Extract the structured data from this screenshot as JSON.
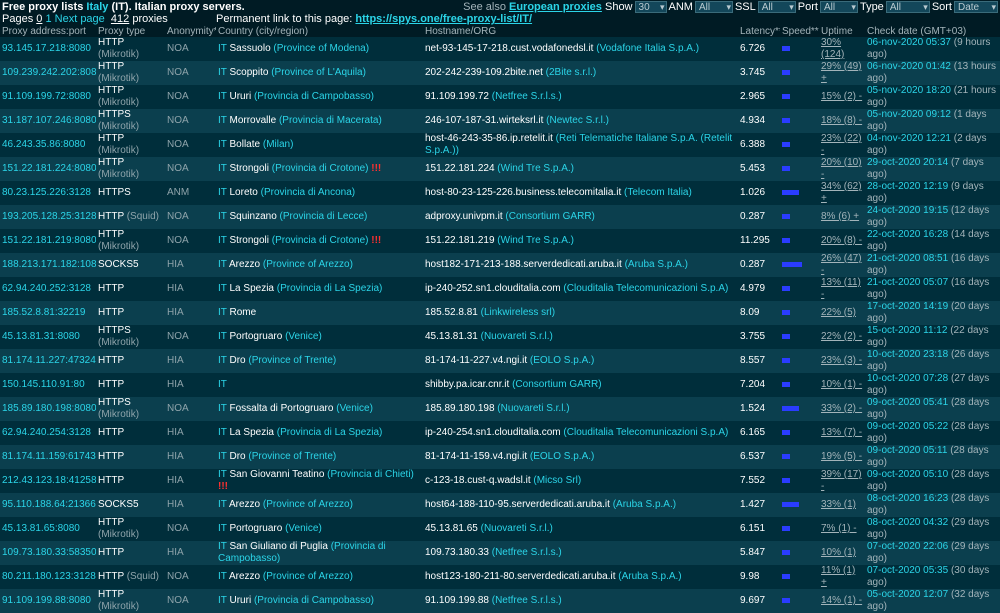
{
  "header": {
    "title_prefix": "Free proxy lists",
    "country": "Italy",
    "title_suffix": "(IT). Italian proxy servers.",
    "permalink_label": "Permanent link to this page:",
    "permalink_url": "https://spys.one/free-proxy-list/IT/",
    "see_also": "See also",
    "european_link": "European proxies",
    "show_label": "Show",
    "show_value": "30",
    "anm_label": "ANM",
    "anm_value": "All",
    "ssl_label": "SSL",
    "ssl_value": "All",
    "port_label": "Port",
    "port_value": "All",
    "type_label": "Type",
    "type_value": "All",
    "sort_label": "Sort",
    "sort_value": "Date"
  },
  "pager": {
    "pages_label": "Pages",
    "page0": "0",
    "page1": "1",
    "next": "Next page",
    "count": "412",
    "count_label": "proxies"
  },
  "columns": [
    "Proxy address:port",
    "Proxy type",
    "Anonymity*",
    "Country (city/region)",
    "Hostname/ORG",
    "Latency**",
    "Speed***",
    "Uptime",
    "Check date (GMT+03)"
  ],
  "rows": [
    {
      "ip": "93.145.17.218:8080",
      "t1": "HTTP",
      "t2": "(Mikrotik)",
      "anon": "NOA",
      "cc": "IT",
      "city": "Sassuolo",
      "prov": "(Province of Modena)",
      "bang": "",
      "host": "net-93-145-17-218.cust.vodafonedsl.it",
      "org": "(Vodafone Italia S.p.A.)",
      "lat": "6.726",
      "spd": 0.25,
      "up": "30% (124)",
      "date": "06-nov-2020 05:37",
      "ago": "(9 hours ago)"
    },
    {
      "ip": "109.239.242.202:8080",
      "t1": "HTTP",
      "t2": "(Mikrotik)",
      "anon": "NOA",
      "cc": "IT",
      "city": "Scoppito",
      "prov": "(Province of L'Aquila)",
      "bang": "",
      "host": "202-242-239-109.2bite.net",
      "org": "(2Bite s.r.l.)",
      "lat": "3.745",
      "spd": 0.25,
      "up": "29% (49) +",
      "date": "06-nov-2020 01:42",
      "ago": "(13 hours ago)"
    },
    {
      "ip": "91.109.199.72:8080",
      "t1": "HTTP",
      "t2": "(Mikrotik)",
      "anon": "NOA",
      "cc": "IT",
      "city": "Ururi",
      "prov": "(Provincia di Campobasso)",
      "bang": "",
      "host": "91.109.199.72",
      "org": "(Netfree S.r.l.s.)",
      "lat": "2.965",
      "spd": 0.25,
      "up": "15% (2) -",
      "date": "05-nov-2020 18:20",
      "ago": "(21 hours ago)"
    },
    {
      "ip": "31.187.107.246:8080",
      "t1": "HTTPS",
      "t2": "(Mikrotik)",
      "anon": "NOA",
      "cc": "IT",
      "city": "Morrovalle",
      "prov": "(Provincia di Macerata)",
      "bang": "",
      "host": "246-107-187-31.wirteksrl.it",
      "org": "(Newtec S.r.l.)",
      "lat": "4.934",
      "spd": 0.25,
      "up": "18% (8) -",
      "date": "05-nov-2020 09:12",
      "ago": "(1 days ago)"
    },
    {
      "ip": "46.243.35.86:8080",
      "t1": "HTTP",
      "t2": "(Mikrotik)",
      "anon": "NOA",
      "cc": "IT",
      "city": "Bollate",
      "prov": "(Milan)",
      "bang": "",
      "host": "host-46-243-35-86.ip.retelit.it",
      "org": "(Reti Telematiche Italiane S.p.A. (Retelit S.p.A.))",
      "lat": "6.388",
      "spd": 0.25,
      "up": "23% (22) -",
      "date": "04-nov-2020 12:21",
      "ago": "(2 days ago)"
    },
    {
      "ip": "151.22.181.224:8080",
      "t1": "HTTP",
      "t2": "(Mikrotik)",
      "anon": "NOA",
      "cc": "IT",
      "city": "Strongoli",
      "prov": "(Provincia di Crotone)",
      "bang": "!!!",
      "host": "151.22.181.224",
      "org": "(Wind Tre S.p.A.)",
      "lat": "5.453",
      "spd": 0.25,
      "up": "20% (10) -",
      "date": "29-oct-2020 20:14",
      "ago": "(7 days ago)"
    },
    {
      "ip": "80.23.125.226:3128",
      "t1": "HTTPS",
      "t2": "",
      "anon": "ANM",
      "cc": "IT",
      "city": "Loreto",
      "prov": "(Provincia di Ancona)",
      "bang": "",
      "host": "host-80-23-125-226.business.telecomitalia.it",
      "org": "(Telecom Italia)",
      "lat": "1.026",
      "spd": 0.55,
      "up": "34% (62) +",
      "date": "28-oct-2020 12:19",
      "ago": "(9 days ago)"
    },
    {
      "ip": "193.205.128.25:3128",
      "t1": "HTTP",
      "t2": "(Squid)",
      "anon": "NOA",
      "cc": "IT",
      "city": "Squinzano",
      "prov": "(Provincia di Lecce)",
      "bang": "",
      "host": "adproxy.univpm.it",
      "org": "(Consortium GARR)",
      "lat": "0.287",
      "spd": 0.25,
      "up": "8% (6) +",
      "date": "24-oct-2020 19:15",
      "ago": "(12 days ago)"
    },
    {
      "ip": "151.22.181.219:8080",
      "t1": "HTTP",
      "t2": "(Mikrotik)",
      "anon": "NOA",
      "cc": "IT",
      "city": "Strongoli",
      "prov": "(Provincia di Crotone)",
      "bang": "!!!",
      "host": "151.22.181.219",
      "org": "(Wind Tre S.p.A.)",
      "lat": "11.295",
      "spd": 0.25,
      "up": "20% (8) -",
      "date": "22-oct-2020 16:28",
      "ago": "(14 days ago)"
    },
    {
      "ip": "188.213.171.182:1080",
      "t1": "SOCKS5",
      "t2": "",
      "anon": "HIA",
      "cc": "IT",
      "city": "Arezzo",
      "prov": "(Province of Arezzo)",
      "bang": "",
      "host": "host182-171-213-188.serverdedicati.aruba.it",
      "org": "(Aruba S.p.A.)",
      "lat": "0.287",
      "spd": 0.65,
      "up": "26% (47) -",
      "date": "21-oct-2020 08:51",
      "ago": "(16 days ago)"
    },
    {
      "ip": "62.94.240.252:3128",
      "t1": "HTTP",
      "t2": "",
      "anon": "HIA",
      "cc": "IT",
      "city": "La Spezia",
      "prov": "(Provincia di La Spezia)",
      "bang": "",
      "host": "ip-240-252.sn1.clouditalia.com",
      "org": "(Clouditalia Telecomunicazioni S.p.A)",
      "lat": "4.979",
      "spd": 0.25,
      "up": "13% (11) -",
      "date": "21-oct-2020 05:07",
      "ago": "(16 days ago)"
    },
    {
      "ip": "185.52.8.81:32219",
      "t1": "HTTP",
      "t2": "",
      "anon": "HIA",
      "cc": "IT",
      "city": "Rome",
      "prov": "",
      "bang": "",
      "host": "185.52.8.81",
      "org": "(Linkwireless srl)",
      "lat": "8.09",
      "spd": 0.25,
      "up": "22% (5)",
      "date": "17-oct-2020 14:19",
      "ago": "(20 days ago)"
    },
    {
      "ip": "45.13.81.31:8080",
      "t1": "HTTPS",
      "t2": "(Mikrotik)",
      "anon": "NOA",
      "cc": "IT",
      "city": "Portogruaro",
      "prov": "(Venice)",
      "bang": "",
      "host": "45.13.81.31",
      "org": "(Nuovareti S.r.l.)",
      "lat": "3.755",
      "spd": 0.25,
      "up": "22% (2) -",
      "date": "15-oct-2020 11:12",
      "ago": "(22 days ago)"
    },
    {
      "ip": "81.174.11.227:47324",
      "t1": "HTTP",
      "t2": "",
      "anon": "HIA",
      "cc": "IT",
      "city": "Dro",
      "prov": "(Province of Trente)",
      "bang": "",
      "host": "81-174-11-227.v4.ngi.it",
      "org": "(EOLO S.p.A.)",
      "lat": "8.557",
      "spd": 0.25,
      "up": "23% (3) -",
      "date": "10-oct-2020 23:18",
      "ago": "(26 days ago)"
    },
    {
      "ip": "150.145.110.91:80",
      "t1": "HTTP",
      "t2": "",
      "anon": "HIA",
      "cc": "IT",
      "city": "",
      "prov": "",
      "bang": "",
      "host": "shibby.pa.icar.cnr.it",
      "org": "(Consortium GARR)",
      "lat": "7.204",
      "spd": 0.25,
      "up": "10% (1) -",
      "date": "10-oct-2020 07:28",
      "ago": "(27 days ago)"
    },
    {
      "ip": "185.89.180.198:8080",
      "t1": "HTTPS",
      "t2": "(Mikrotik)",
      "anon": "NOA",
      "cc": "IT",
      "city": "Fossalta di Portogruaro",
      "prov": "(Venice)",
      "bang": "",
      "host": "185.89.180.198",
      "org": "(Nuovareti S.r.l.)",
      "lat": "1.524",
      "spd": 0.55,
      "up": "33% (2) -",
      "date": "09-oct-2020 05:41",
      "ago": "(28 days ago)"
    },
    {
      "ip": "62.94.240.254:3128",
      "t1": "HTTP",
      "t2": "",
      "anon": "HIA",
      "cc": "IT",
      "city": "La Spezia",
      "prov": "(Provincia di La Spezia)",
      "bang": "",
      "host": "ip-240-254.sn1.clouditalia.com",
      "org": "(Clouditalia Telecomunicazioni S.p.A)",
      "lat": "6.165",
      "spd": 0.25,
      "up": "13% (7) -",
      "date": "09-oct-2020 05:22",
      "ago": "(28 days ago)"
    },
    {
      "ip": "81.174.11.159:61743",
      "t1": "HTTP",
      "t2": "",
      "anon": "HIA",
      "cc": "IT",
      "city": "Dro",
      "prov": "(Province of Trente)",
      "bang": "",
      "host": "81-174-11-159.v4.ngi.it",
      "org": "(EOLO S.p.A.)",
      "lat": "6.537",
      "spd": 0.25,
      "up": "19% (5) -",
      "date": "09-oct-2020 05:11",
      "ago": "(28 days ago)"
    },
    {
      "ip": "212.43.123.18:41258",
      "t1": "HTTP",
      "t2": "",
      "anon": "HIA",
      "cc": "IT",
      "city": "San Giovanni Teatino",
      "prov": "(Provincia di Chieti)",
      "bang": "!!!",
      "host": "c-123-18.cust-q.wadsl.it",
      "org": "(Micso Srl)",
      "lat": "7.552",
      "spd": 0.25,
      "up": "39% (17) -",
      "date": "09-oct-2020 05:10",
      "ago": "(28 days ago)"
    },
    {
      "ip": "95.110.188.64:21366",
      "t1": "SOCKS5",
      "t2": "",
      "anon": "HIA",
      "cc": "IT",
      "city": "Arezzo",
      "prov": "(Province of Arezzo)",
      "bang": "",
      "host": "host64-188-110-95.serverdedicati.aruba.it",
      "org": "(Aruba S.p.A.)",
      "lat": "1.427",
      "spd": 0.55,
      "up": "33% (1)",
      "date": "08-oct-2020 16:23",
      "ago": "(28 days ago)"
    },
    {
      "ip": "45.13.81.65:8080",
      "t1": "HTTP",
      "t2": "(Mikrotik)",
      "anon": "NOA",
      "cc": "IT",
      "city": "Portogruaro",
      "prov": "(Venice)",
      "bang": "",
      "host": "45.13.81.65",
      "org": "(Nuovareti S.r.l.)",
      "lat": "6.151",
      "spd": 0.25,
      "up": "7% (1) -",
      "date": "08-oct-2020 04:32",
      "ago": "(29 days ago)"
    },
    {
      "ip": "109.73.180.33:58350",
      "t1": "HTTP",
      "t2": "",
      "anon": "HIA",
      "cc": "IT",
      "city": "San Giuliano di Puglia",
      "prov": "(Provincia di Campobasso)",
      "bang": "",
      "host": "109.73.180.33",
      "org": "(Netfree S.r.l.s.)",
      "lat": "5.847",
      "spd": 0.25,
      "up": "10% (1)",
      "date": "07-oct-2020 22:06",
      "ago": "(29 days ago)"
    },
    {
      "ip": "80.211.180.123:3128",
      "t1": "HTTP",
      "t2": "(Squid)",
      "anon": "NOA",
      "cc": "IT",
      "city": "Arezzo",
      "prov": "(Province of Arezzo)",
      "bang": "",
      "host": "host123-180-211-80.serverdedicati.aruba.it",
      "org": "(Aruba S.p.A.)",
      "lat": "9.98",
      "spd": 0.25,
      "up": "11% (1) +",
      "date": "07-oct-2020 05:35",
      "ago": "(30 days ago)"
    },
    {
      "ip": "91.109.199.88:8080",
      "t1": "HTTP",
      "t2": "(Mikrotik)",
      "anon": "NOA",
      "cc": "IT",
      "city": "Ururi",
      "prov": "(Provincia di Campobasso)",
      "bang": "",
      "host": "91.109.199.88",
      "org": "(Netfree S.r.l.s.)",
      "lat": "9.697",
      "spd": 0.25,
      "up": "14% (1) -",
      "date": "05-oct-2020 12:07",
      "ago": "(32 days ago)"
    }
  ]
}
